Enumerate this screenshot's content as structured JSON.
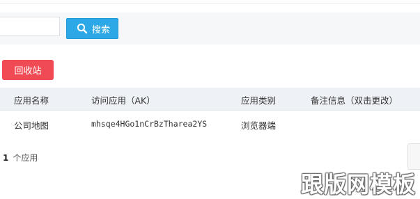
{
  "search": {
    "value": "",
    "button_label": "搜索"
  },
  "toolbar": {
    "recycle_label": "回收站"
  },
  "table": {
    "headers": [
      "应用名称",
      "访问应用（AK）",
      "应用类别",
      "备注信息（双击更改）"
    ],
    "rows": [
      [
        "公司地图",
        "mhsqe4HGo1nCrBzTharea2YS",
        "浏览器端",
        ""
      ]
    ]
  },
  "footer": {
    "count": "1",
    "count_suffix": "个应用"
  },
  "watermark": "跟版网模板",
  "colors": {
    "search_button": "#2ba8e5",
    "recycle_button": "#f04a55",
    "header_bg": "#eef1f5"
  }
}
